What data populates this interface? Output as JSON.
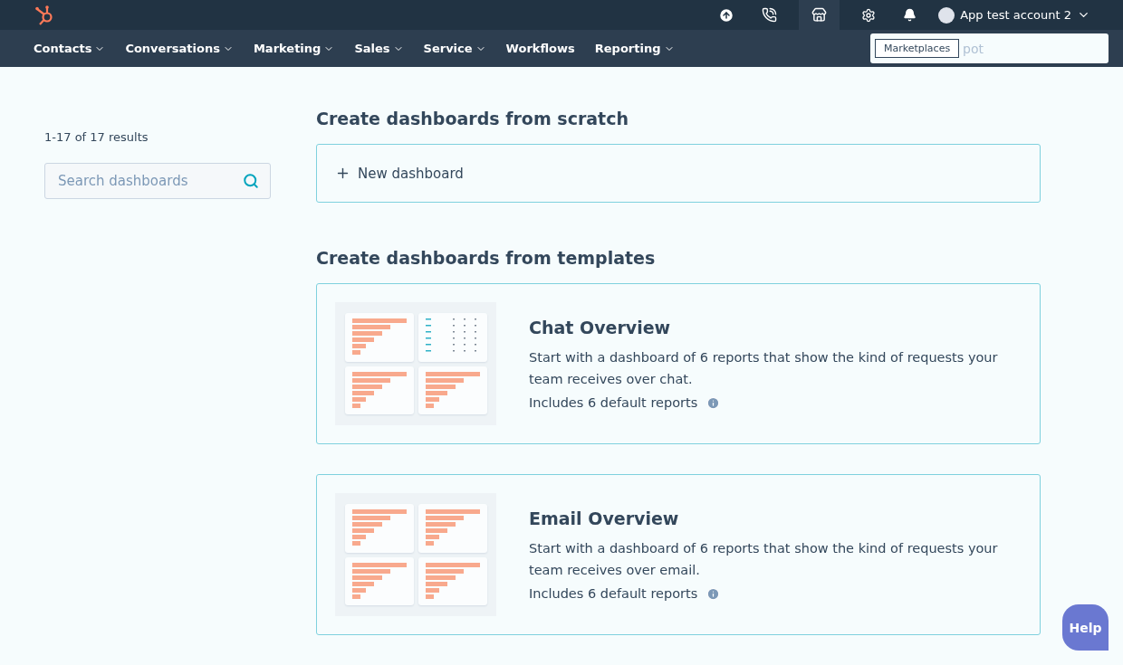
{
  "topbar": {
    "account": "App test account 2",
    "tooltip": "Marketplaces"
  },
  "nav": {
    "items": [
      {
        "label": "Contacts",
        "dropdown": true
      },
      {
        "label": "Conversations",
        "dropdown": true
      },
      {
        "label": "Marketing",
        "dropdown": true
      },
      {
        "label": "Sales",
        "dropdown": true
      },
      {
        "label": "Service",
        "dropdown": true
      },
      {
        "label": "Workflows",
        "dropdown": false
      },
      {
        "label": "Reporting",
        "dropdown": true
      }
    ],
    "search": {
      "placeholder": "pot"
    }
  },
  "sidebar": {
    "results": "1-17 of 17 results",
    "search": {
      "placeholder": "Search dashboards"
    }
  },
  "scratch": {
    "heading": "Create dashboards from scratch",
    "button": "New dashboard"
  },
  "templates": {
    "heading": "Create dashboards from templates",
    "items": [
      {
        "title": "Chat Overview",
        "description": "Start with a dashboard of 6 reports that show the kind of requests your team receives over chat.",
        "reports": "Includes 6 default reports",
        "panels": [
          {
            "kind": "bars"
          },
          {
            "kind": "table"
          },
          {
            "kind": "bars"
          },
          {
            "kind": "bars"
          }
        ]
      },
      {
        "title": "Email Overview",
        "description": "Start with a dashboard of 6 reports that show the kind of requests your team receives over email.",
        "reports": "Includes 6 default reports",
        "panels": [
          {
            "kind": "bars"
          },
          {
            "kind": "bars"
          },
          {
            "kind": "bars"
          },
          {
            "kind": "bars"
          }
        ]
      }
    ]
  },
  "help": "Help"
}
